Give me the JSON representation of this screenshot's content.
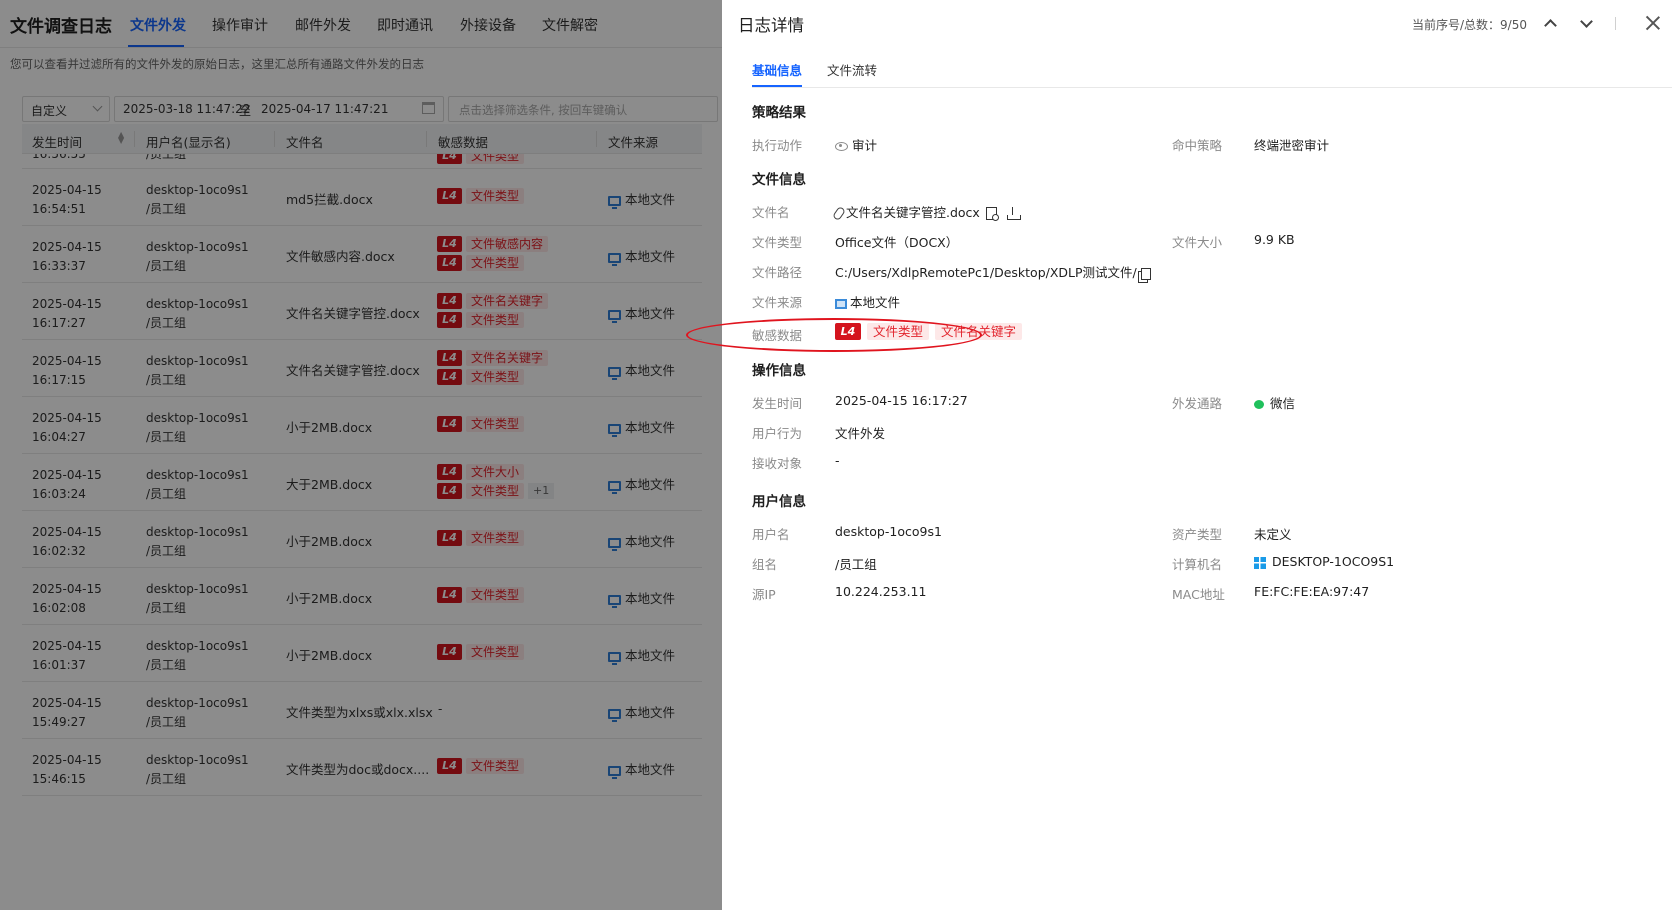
{
  "app": {
    "title": "文件调查日志",
    "nav_tabs": [
      "文件外发",
      "操作审计",
      "邮件外发",
      "即时通讯",
      "外接设备",
      "文件解密"
    ],
    "subtitle": "您可以查看并过滤所有的文件外发的原始日志，这里汇总所有通路文件外发的日志"
  },
  "filters": {
    "range_select": "自定义",
    "date_start": "2025-03-18 11:47:22",
    "date_sep": "至",
    "date_end": "2025-04-17 11:47:21",
    "search_placeholder": "点击选择筛选条件, 按回车键确认"
  },
  "table": {
    "columns": [
      "发生时间",
      "用户名(显示名)",
      "文件名",
      "敏感数据",
      "文件来源"
    ],
    "partial_row": {
      "time": "16:56:55",
      "group": "/员工组",
      "tag": "文件类型"
    },
    "rows": [
      {
        "date": "2025-04-15",
        "time": "16:54:51",
        "user": "desktop-1oco9s1",
        "group": "/员工组",
        "file": "md5拦截.docx",
        "tags": [
          "文件类型"
        ],
        "more": "",
        "source": "本地文件"
      },
      {
        "date": "2025-04-15",
        "time": "16:33:37",
        "user": "desktop-1oco9s1",
        "group": "/员工组",
        "file": "文件敏感内容.docx",
        "tags": [
          "文件敏感内容",
          "文件类型"
        ],
        "more": "",
        "source": "本地文件"
      },
      {
        "date": "2025-04-15",
        "time": "16:17:27",
        "user": "desktop-1oco9s1",
        "group": "/员工组",
        "file": "文件名关键字管控.docx",
        "tags": [
          "文件名关键字",
          "文件类型"
        ],
        "more": "",
        "source": "本地文件"
      },
      {
        "date": "2025-04-15",
        "time": "16:17:15",
        "user": "desktop-1oco9s1",
        "group": "/员工组",
        "file": "文件名关键字管控.docx",
        "tags": [
          "文件名关键字",
          "文件类型"
        ],
        "more": "",
        "source": "本地文件"
      },
      {
        "date": "2025-04-15",
        "time": "16:04:27",
        "user": "desktop-1oco9s1",
        "group": "/员工组",
        "file": "小于2MB.docx",
        "tags": [
          "文件类型"
        ],
        "more": "",
        "source": "本地文件"
      },
      {
        "date": "2025-04-15",
        "time": "16:03:24",
        "user": "desktop-1oco9s1",
        "group": "/员工组",
        "file": "大于2MB.docx",
        "tags": [
          "文件大小",
          "文件类型"
        ],
        "more": "+1",
        "source": "本地文件"
      },
      {
        "date": "2025-04-15",
        "time": "16:02:32",
        "user": "desktop-1oco9s1",
        "group": "/员工组",
        "file": "小于2MB.docx",
        "tags": [
          "文件类型"
        ],
        "more": "",
        "source": "本地文件"
      },
      {
        "date": "2025-04-15",
        "time": "16:02:08",
        "user": "desktop-1oco9s1",
        "group": "/员工组",
        "file": "小于2MB.docx",
        "tags": [
          "文件类型"
        ],
        "more": "",
        "source": "本地文件"
      },
      {
        "date": "2025-04-15",
        "time": "16:01:37",
        "user": "desktop-1oco9s1",
        "group": "/员工组",
        "file": "小于2MB.docx",
        "tags": [
          "文件类型"
        ],
        "more": "",
        "source": "本地文件"
      },
      {
        "date": "2025-04-15",
        "time": "15:49:27",
        "user": "desktop-1oco9s1",
        "group": "/员工组",
        "file": "文件类型为xlxs或xlx.xlsx",
        "tags": [],
        "more": "",
        "source": "本地文件"
      },
      {
        "date": "2025-04-15",
        "time": "15:46:15",
        "user": "desktop-1oco9s1",
        "group": "/员工组",
        "file": "文件类型为doc或docx....",
        "tags": [
          "文件类型"
        ],
        "more": "",
        "source": "本地文件"
      }
    ],
    "level_badge": "L4",
    "empty_value": "-"
  },
  "drawer": {
    "title": "日志详情",
    "counter": "当前序号/总数：9/50",
    "tabs": [
      "基础信息",
      "文件流转"
    ],
    "policy": {
      "heading": "策略结果",
      "action_label": "执行动作",
      "action_value": "审计",
      "hit_label": "命中策略",
      "hit_value": "终端泄密审计"
    },
    "file": {
      "heading": "文件信息",
      "name_label": "文件名",
      "name_value": "文件名关键字管控.docx",
      "type_label": "文件类型",
      "type_value": "Office文件（DOCX）",
      "size_label": "文件大小",
      "size_value": "9.9 KB",
      "path_label": "文件路径",
      "path_value": "C:/Users/XdlpRemotePc1/Desktop/XDLP测试文件/",
      "source_label": "文件来源",
      "source_value": "本地文件",
      "sens_label": "敏感数据",
      "sens_level": "L4",
      "sens_tags": [
        "文件类型",
        "文件名关键字"
      ]
    },
    "operation": {
      "heading": "操作信息",
      "time_label": "发生时间",
      "time_value": "2025-04-15 16:17:27",
      "channel_label": "外发通路",
      "channel_value": "微信",
      "behavior_label": "用户行为",
      "behavior_value": "文件外发",
      "receiver_label": "接收对象",
      "receiver_value": "-"
    },
    "user": {
      "heading": "用户信息",
      "username_label": "用户名",
      "username_value": "desktop-1oco9s1",
      "asset_label": "资产类型",
      "asset_value": "未定义",
      "group_label": "组名",
      "group_value": "/员工组",
      "host_label": "计算机名",
      "host_value": "DESKTOP-1OCO9S1",
      "ip_label": "源IP",
      "ip_value": "10.224.253.11",
      "mac_label": "MAC地址",
      "mac_value": "FE:FC:FE:EA:97:47"
    }
  },
  "colors": {
    "accent": "#1664ff",
    "danger": "#d4141e",
    "tag_bg": "#fde8e8",
    "annotation": "#e0141e"
  }
}
